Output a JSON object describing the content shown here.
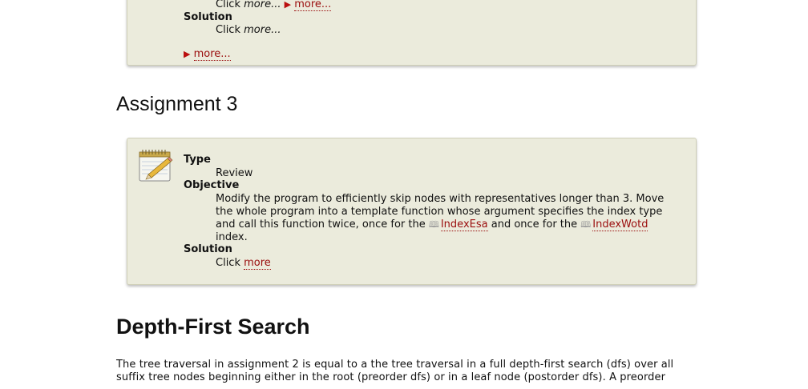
{
  "box1": {
    "line_click": "Click",
    "line_more_italic": "more...",
    "line_more_link": "more...",
    "solution_label": "Solution",
    "solution_click": "Click",
    "solution_more_italic": "more...",
    "bottom_more_link": "more..."
  },
  "assignment3": {
    "heading": "Assignment 3",
    "type_label": "Type",
    "type_value": "Review",
    "objective_label": "Objective",
    "objective_line1": "Modify the program to efficiently skip nodes with representatives longer than 3. Move",
    "objective_line2": "the whole program into a template function whose argument specifies the index type",
    "objective_line3_a": "and call this function twice, once for the",
    "objective_link1": "IndexEsa",
    "objective_line3_b": "and once for the",
    "objective_link2": "IndexWotd",
    "objective_line4": "index.",
    "solution_label": "Solution",
    "solution_click": "Click",
    "solution_more": "more"
  },
  "dfs": {
    "heading": "Depth-First Search",
    "para_line1": "The tree traversal in assignment 2 is equal to a the tree traversal in a full depth-first search (dfs) over all",
    "para_line2": "suffix tree nodes beginning either in the root (preorder dfs) or in a leaf node (postorder dfs). A preorder"
  },
  "icons": {
    "notepad": "notepad-pencil-icon",
    "book": "book-icon",
    "triangle": "triangle-right-icon"
  },
  "colors": {
    "box_bg": "#ebebdc",
    "link": "#9a0d0d"
  }
}
